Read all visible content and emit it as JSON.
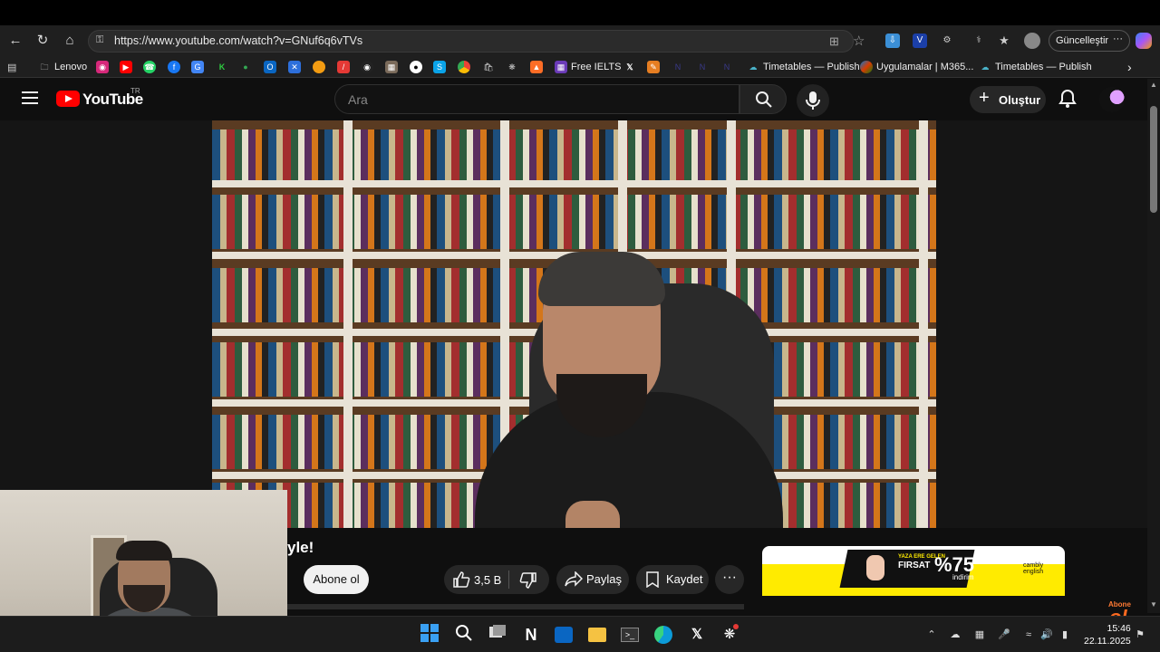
{
  "browser": {
    "url": "https://www.youtube.com/watch?v=GNuf6q6vTVs",
    "update_label": "Güncelleştir",
    "bookmarks": [
      {
        "label": "Lenovo"
      },
      {
        "label": "Free IELTS"
      },
      {
        "label": "Timetables — Publish"
      },
      {
        "label": "Uygulamalar | M365..."
      },
      {
        "label": "Timetables — Publish"
      }
    ]
  },
  "youtube": {
    "brand": "YouTube",
    "region": "TR",
    "search_placeholder": "Ara",
    "create_label": "Oluştur"
  },
  "video": {
    "title_fragment": "yle!",
    "watermark_top": "Abone",
    "watermark_bottom": "ol",
    "subscribe_label": "Abone ol",
    "like_count": "3,5 B",
    "share_label": "Paylaş",
    "save_label": "Kaydet"
  },
  "ad": {
    "headline": "FIRSAT",
    "headline_top": "YAZA ERE GELEN",
    "discount": "%75",
    "discount_label": "indirim",
    "brand": "cambly english"
  },
  "taskbar": {
    "time": "15:46",
    "date": "22.11.2025"
  },
  "colors": {
    "youtube_red": "#ff0000",
    "background": "#0f0f0f",
    "ad_yellow": "#ffeb00"
  }
}
